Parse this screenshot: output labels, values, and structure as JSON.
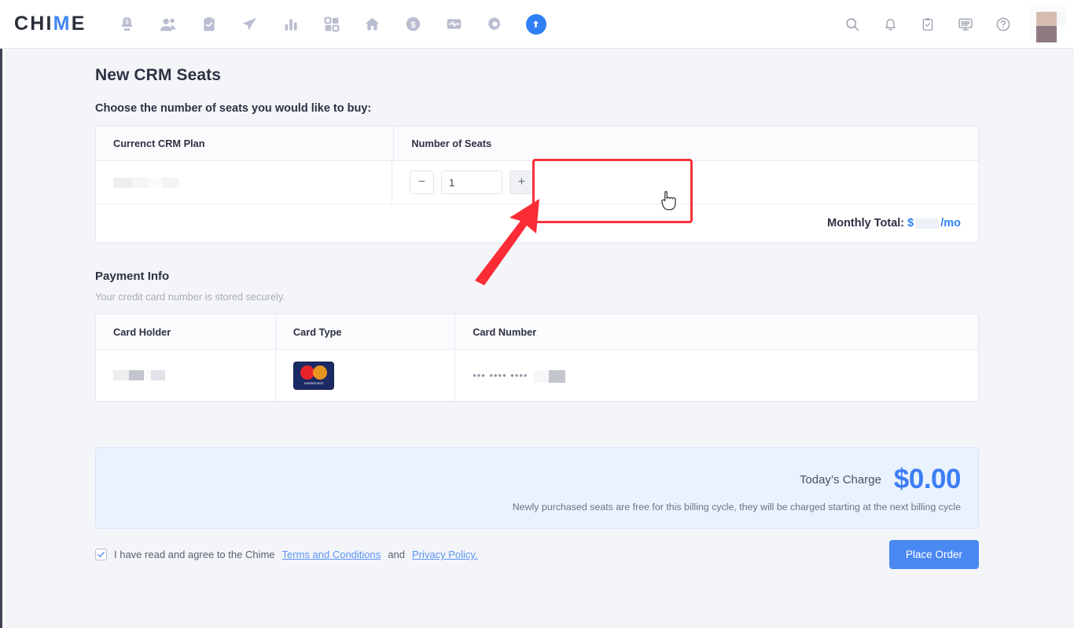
{
  "brand": {
    "name_part1": "CHI",
    "name_check": "M",
    "name_part2": "E"
  },
  "topnav": {
    "left_icons": [
      {
        "name": "dollar-bell-icon",
        "label": "Alerts"
      },
      {
        "name": "contacts-icon",
        "label": "Contacts"
      },
      {
        "name": "clipboard-check-icon",
        "label": "Tasks"
      },
      {
        "name": "send-icon",
        "label": "Campaigns"
      },
      {
        "name": "bar-chart-icon",
        "label": "Reports"
      },
      {
        "name": "dashboard-grid-icon",
        "label": "Dashboard"
      },
      {
        "name": "home-icon",
        "label": "Listings"
      },
      {
        "name": "dollar-circle-icon",
        "label": "Transactions"
      },
      {
        "name": "pulse-icon",
        "label": "Activity"
      },
      {
        "name": "gear-icon",
        "label": "Settings"
      },
      {
        "name": "upgrade-arrow-icon",
        "label": "Upgrade"
      }
    ],
    "right_icons": [
      {
        "name": "search-icon",
        "label": "Search"
      },
      {
        "name": "bell-icon",
        "label": "Notifications"
      },
      {
        "name": "clipboard-icon",
        "label": "To-dos"
      },
      {
        "name": "monitor-list-icon",
        "label": "Feed"
      },
      {
        "name": "help-icon",
        "label": "Help"
      }
    ],
    "avatar_name": "user-avatar",
    "accent_color": "#2f80f5"
  },
  "page": {
    "title": "New CRM Seats",
    "subtitle": "Choose the number of seats you would like to buy:"
  },
  "seats_table": {
    "headers": [
      "Currenct CRM Plan",
      "Number of Seats"
    ],
    "plan_value_redacted": true,
    "seat_count": "1",
    "minus_label": "−",
    "plus_label": "+",
    "total_label": "Monthly Total:",
    "total_currency": "$",
    "total_amount_redacted": true,
    "total_suffix": "/mo"
  },
  "payment": {
    "title": "Payment Info",
    "note": "Your credit card number is stored securely.",
    "headers": [
      "Card Holder",
      "Card Type",
      "Card Number"
    ],
    "card_holder_redacted": true,
    "card_type": "mastercard",
    "card_type_word": "mastercard",
    "card_number_mask": "••• •••• ••••",
    "card_number_last4_redacted": true
  },
  "charge": {
    "label": "Today’s Charge",
    "amount": "$0.00",
    "note": "Newly purchased seats are free for this  billing cycle, they will be charged starting at the next billing cycle",
    "amount_color": "#3d7df6",
    "panel_color": "#e9f2fd"
  },
  "footer": {
    "checkbox_checked": true,
    "agree_prefix": "I have read and agree to the Chime ",
    "terms_link": "Terms and Conditions",
    "agree_middle": " and ",
    "privacy_link": "Privacy Policy.",
    "place_order_label": "Place Order",
    "button_color": "#4a88f2"
  },
  "annotations": {
    "highlight_box_name": "number-of-seats-highlight",
    "highlight_color": "#f8323c",
    "arrow_name": "pointer-arrow",
    "cursor_name": "mouse-cursor-pointer"
  }
}
